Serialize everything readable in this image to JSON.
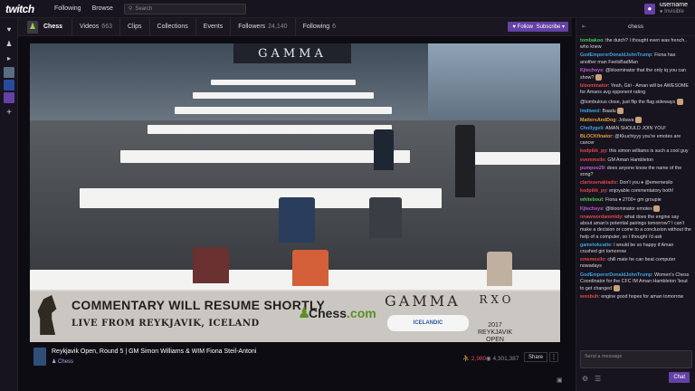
{
  "topbar": {
    "logo": "twitch",
    "links": [
      "Following",
      "Browse"
    ],
    "search_placeholder": "Search",
    "user": {
      "name": "username",
      "status": "● Invisible"
    }
  },
  "leftnav": {
    "icons": [
      "heart-icon",
      "add-friends-icon",
      "video-icon",
      "chat-bubble-icon"
    ],
    "add_label": "+"
  },
  "channel": {
    "name": "Chess",
    "tabs": [
      {
        "label": "Videos",
        "count": "663"
      },
      {
        "label": "Clips",
        "count": ""
      },
      {
        "label": "Collections",
        "count": ""
      },
      {
        "label": "Events",
        "count": ""
      },
      {
        "label": "Followers",
        "count": "24,140"
      },
      {
        "label": "Following",
        "count": "6"
      }
    ],
    "follow_label": "♥ Follow",
    "subscribe_label": "Subscribe ▾"
  },
  "video": {
    "banner": "GAMMA",
    "overlay_title": "COMMENTARY WILL RESUME SHORTLY",
    "overlay_subtitle": "LIVE FROM REYKJAVIK, ICELAND",
    "chess_logo": "Chess",
    "chess_logo_dot": ".com",
    "sponsor": "GAMMA",
    "bottle_label": "ICELANDIC",
    "event_mark": "R X O",
    "event_year": "2017",
    "event_name": "REYKJAVIK OPEN"
  },
  "info": {
    "title": "Reykjavik Open, Round 5 | GM Simon Williams & WIM Fiona Steil-Antoni",
    "game": "Chess",
    "viewers": "⛹ 2,980",
    "views": "◉ 4,301,387",
    "share_label": "Share",
    "more_label": "⋮"
  },
  "chat": {
    "header": "chess",
    "messages": [
      {
        "name": "tombakoo",
        "color": "#4bc94b",
        "text": "the dutch? I thought even was french.. who knew",
        "emote": false
      },
      {
        "name": "GodEmperorDonaldJohnTrump",
        "color": "#3fa4e0",
        "text": "Fiona has another man FeelsBadMan",
        "emote": false
      },
      {
        "name": "Kjtechsys",
        "color": "#c05cd1",
        "text": "@bloominator that the only iq you can show?",
        "emote": true
      },
      {
        "name": "bloomtnator",
        "color": "#e04848",
        "text": "Yeah, Giri - Aman will be AWESOME for Amans avg opponent rating",
        "emote": false
      },
      {
        "name": "",
        "color": "#dad8de",
        "text": "@tombulous close, just flip the flag sideways",
        "emote": true
      },
      {
        "name": "lmdtwed",
        "color": "#3fa4e0",
        "text": "Baadu",
        "emote": true
      },
      {
        "name": "MattersAndDog",
        "color": "#e0a040",
        "text": "Jobava",
        "emote": true
      },
      {
        "name": "Chollygeli",
        "color": "#3fa4e0",
        "text": "AMAN SHOULD JOIN YOU!",
        "emote": false
      },
      {
        "name": "BLOCKfinator",
        "color": "#e0a040",
        "text": "@Kkuchiyyy you're emotes are cancer",
        "emote": false
      },
      {
        "name": "kodpikk_py",
        "color": "#e04848",
        "text": "this simon williams is such a cool guy",
        "emote": false
      },
      {
        "name": "evemmsilo",
        "color": "#e04848",
        "text": "GM Aman Hambleton",
        "emote": false
      },
      {
        "name": "pumpoo29",
        "color": "#c05cd1",
        "text": "does anyone know the name of the song?",
        "emote": false
      },
      {
        "name": "clarissenakiadiz",
        "color": "#e04848",
        "text": "Don't you ♦ @ememesilo",
        "emote": false
      },
      {
        "name": "kodpikk_py",
        "color": "#e04848",
        "text": "enjoyable commentatory both!",
        "emote": false
      },
      {
        "name": "whitebout",
        "color": "#4bc94b",
        "text": "Fiona ♦ 2700+ gm groupie",
        "emote": false
      },
      {
        "name": "Kjtechsys",
        "color": "#c05cd1",
        "text": "@bloominator emotes",
        "emote": true
      },
      {
        "name": "nnawwordammidy",
        "color": "#e04848",
        "text": "what does the engine say about aman's potential pairings tomorrow? I can't make a decision or come to a conclusion without the help of a computer, so I thought i'd ask",
        "emote": false
      },
      {
        "name": "gametokcatte",
        "color": "#3fa4e0",
        "text": "I would be so happy if Aman crushed giri tomorrow",
        "emote": false
      },
      {
        "name": "ememesilo",
        "color": "#e04848",
        "text": "chill mate he can beat computer nowadays",
        "emote": false
      },
      {
        "name": "GodEmperorDonaldJohnTrump",
        "color": "#3fa4e0",
        "text": "Women's Chess Coordinator for the CFC IM Aman Hambleton 'bout to get changed",
        "emote": true
      },
      {
        "name": "woobuh",
        "color": "#e04848",
        "text": "engine good hopes for aman tomorrow",
        "emote": false
      }
    ],
    "input_placeholder": "Send a message",
    "chat_button": "Chat"
  },
  "colors": {
    "accent": "#6441a4",
    "bg": "#0e0c13",
    "panel": "#17141f"
  }
}
